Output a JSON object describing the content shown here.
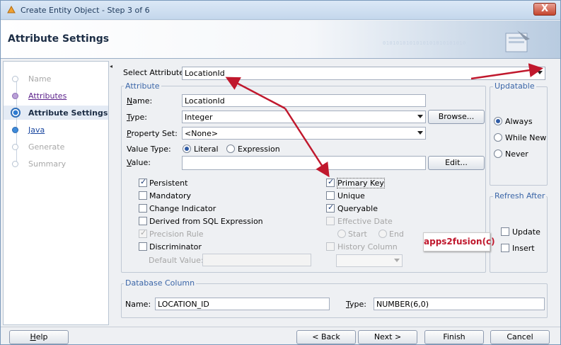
{
  "window": {
    "title": "Create Entity Object - Step 3 of 6",
    "close_label": "X"
  },
  "header": {
    "title": "Attribute Settings",
    "bits": "0101010101010101010101010"
  },
  "nav": [
    {
      "label": "Name",
      "state": "disabled"
    },
    {
      "label": "Attributes",
      "state": "done"
    },
    {
      "label": "Attribute Settings",
      "state": "current"
    },
    {
      "label": "Java",
      "state": "next"
    },
    {
      "label": "Generate",
      "state": "disabled"
    },
    {
      "label": "Summary",
      "state": "disabled"
    }
  ],
  "select_attribute": {
    "label": "Select Attribute",
    "value": "LocationId"
  },
  "attribute": {
    "group_title": "Attribute",
    "name_label": "Name:",
    "name_value": "LocationId",
    "type_label": "Type:",
    "type_value": "Integer",
    "browse_label": "Browse...",
    "property_set_label": "Property Set:",
    "property_set_value": "<None>",
    "value_type_label": "Value Type:",
    "literal_label": "Literal",
    "expression_label": "Expression",
    "value_label": "Value:",
    "value_value": "",
    "edit_label": "Edit...",
    "persistent": "Persistent",
    "mandatory": "Mandatory",
    "change_indicator": "Change Indicator",
    "derived_sql": "Derived from SQL Expression",
    "precision_rule": "Precision Rule",
    "discriminator": "Discriminator",
    "default_value": "Default Value:",
    "primary_key": "Primary Key",
    "unique": "Unique",
    "queryable": "Queryable",
    "effective_date": "Effective Date",
    "start": "Start",
    "end": "End",
    "history_column": "History Column"
  },
  "updatable": {
    "title": "Updatable",
    "always": "Always",
    "while_new": "While New",
    "never": "Never"
  },
  "refresh_after": {
    "title": "Refresh After",
    "update": "Update",
    "insert": "Insert"
  },
  "watermark": "apps2fusion(c)",
  "database_column": {
    "title": "Database Column",
    "name_label": "Name:",
    "name_value": "LOCATION_ID",
    "type_label": "Type:",
    "type_value": "NUMBER(6,0)"
  },
  "footer": {
    "help": "Help",
    "back": "< Back",
    "next": "Next >",
    "finish": "Finish",
    "cancel": "Cancel"
  },
  "colors": {
    "annotation_arrow": "#c0182d",
    "accent": "#3b66a8"
  }
}
